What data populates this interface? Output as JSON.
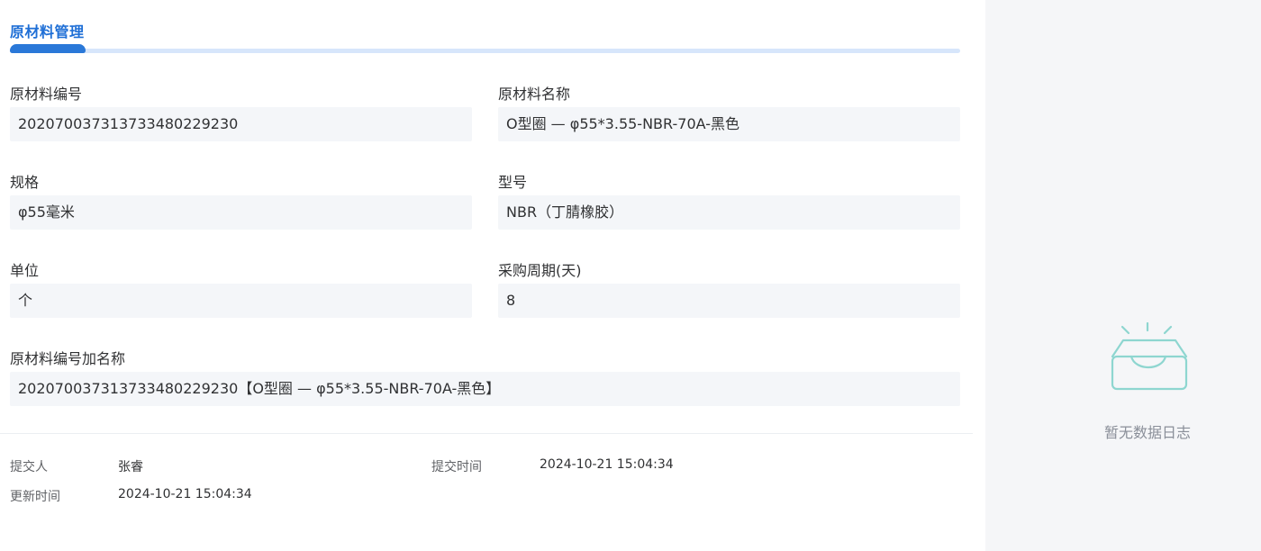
{
  "tab": {
    "title": "原材料管理"
  },
  "fields": {
    "code": {
      "label": "原材料编号",
      "value": "202070037313733480229230"
    },
    "name": {
      "label": "原材料名称",
      "value": "O型圈 — φ55*3.55-NBR-70A-黑色"
    },
    "spec": {
      "label": "规格",
      "value": "φ55毫米"
    },
    "model": {
      "label": "型号",
      "value": "NBR（丁腈橡胶）"
    },
    "unit": {
      "label": "单位",
      "value": "个"
    },
    "cycle": {
      "label": "采购周期(天)",
      "value": "8"
    },
    "code_name": {
      "label": "原材料编号加名称",
      "value": "202070037313733480229230【O型圈 — φ55*3.55-NBR-70A-黑色】"
    }
  },
  "meta": {
    "submitter_label": "提交人",
    "submitter_value": "张睿",
    "submit_time_label": "提交时间",
    "submit_time_value": "2024-10-21 15:04:34",
    "update_time_label": "更新时间",
    "update_time_value": "2024-10-21 15:04:34"
  },
  "log_panel": {
    "empty_text": "暂无数据日志",
    "icon": "empty-inbox-icon",
    "accent": "#8ed6d0"
  }
}
